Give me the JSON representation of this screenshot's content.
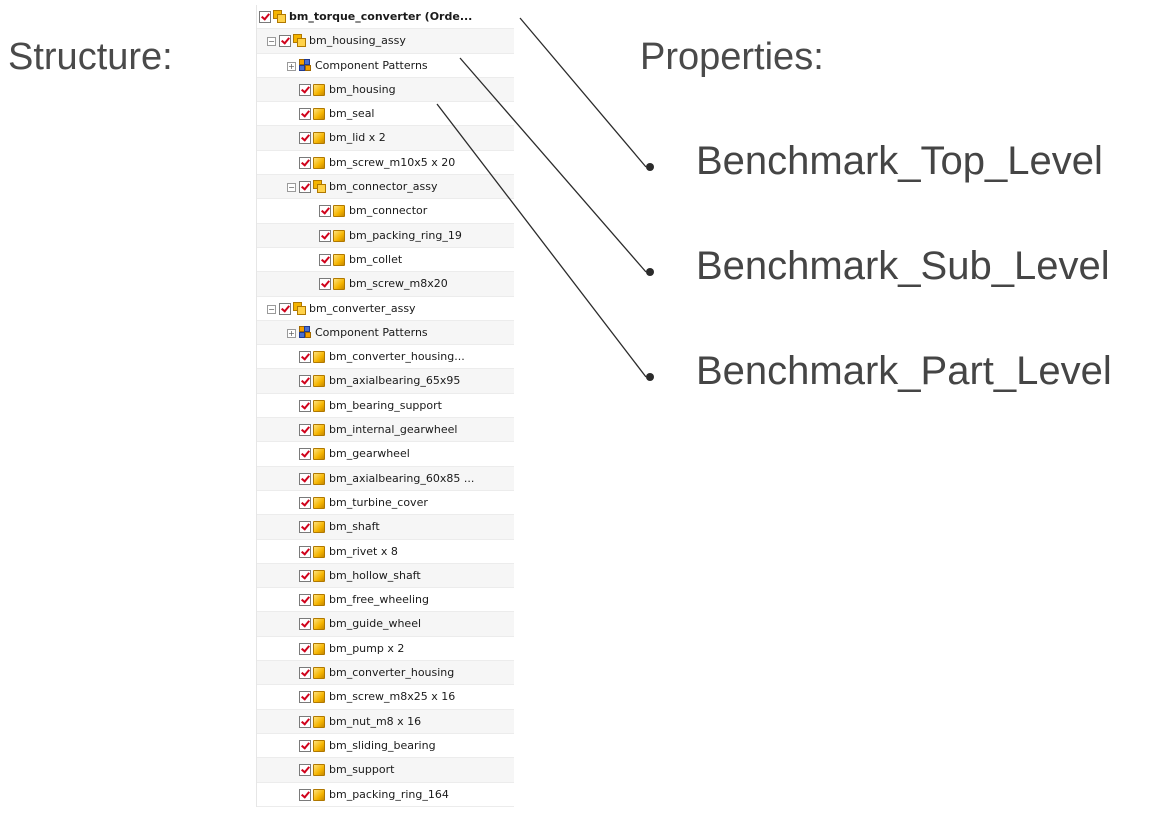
{
  "headings": {
    "structure": "Structure:",
    "properties": "Properties:"
  },
  "tree": [
    {
      "label": "bm_torque_converter (Orde...",
      "level": 0,
      "type": "asm",
      "expander": "",
      "bold": true
    },
    {
      "label": "bm_housing_assy",
      "level": 1,
      "type": "asm",
      "expander": "−"
    },
    {
      "label": "Component Patterns",
      "level": 2,
      "type": "pattern",
      "expander": "+"
    },
    {
      "label": "bm_housing",
      "level": 2,
      "type": "part",
      "expander": ""
    },
    {
      "label": "bm_seal",
      "level": 2,
      "type": "part",
      "expander": ""
    },
    {
      "label": "bm_lid x 2",
      "level": 2,
      "type": "part",
      "expander": ""
    },
    {
      "label": "bm_screw_m10x5 x 20",
      "level": 2,
      "type": "part",
      "expander": ""
    },
    {
      "label": "bm_connector_assy",
      "level": 2,
      "type": "asm",
      "expander": "−"
    },
    {
      "label": "bm_connector",
      "level": 3,
      "type": "part",
      "expander": ""
    },
    {
      "label": "bm_packing_ring_19",
      "level": 3,
      "type": "part",
      "expander": ""
    },
    {
      "label": "bm_collet",
      "level": 3,
      "type": "part",
      "expander": ""
    },
    {
      "label": "bm_screw_m8x20",
      "level": 3,
      "type": "part",
      "expander": ""
    },
    {
      "label": "bm_converter_assy",
      "level": 1,
      "type": "asm",
      "expander": "−"
    },
    {
      "label": "Component Patterns",
      "level": 2,
      "type": "pattern",
      "expander": "+"
    },
    {
      "label": "bm_converter_housing...",
      "level": 2,
      "type": "part",
      "expander": ""
    },
    {
      "label": "bm_axialbearing_65x95",
      "level": 2,
      "type": "part",
      "expander": ""
    },
    {
      "label": "bm_bearing_support",
      "level": 2,
      "type": "part",
      "expander": ""
    },
    {
      "label": "bm_internal_gearwheel",
      "level": 2,
      "type": "part",
      "expander": ""
    },
    {
      "label": "bm_gearwheel",
      "level": 2,
      "type": "part",
      "expander": ""
    },
    {
      "label": "bm_axialbearing_60x85 ...",
      "level": 2,
      "type": "part",
      "expander": ""
    },
    {
      "label": "bm_turbine_cover",
      "level": 2,
      "type": "part",
      "expander": ""
    },
    {
      "label": "bm_shaft",
      "level": 2,
      "type": "part",
      "expander": ""
    },
    {
      "label": "bm_rivet x 8",
      "level": 2,
      "type": "part",
      "expander": ""
    },
    {
      "label": "bm_hollow_shaft",
      "level": 2,
      "type": "part",
      "expander": ""
    },
    {
      "label": "bm_free_wheeling",
      "level": 2,
      "type": "part",
      "expander": ""
    },
    {
      "label": "bm_guide_wheel",
      "level": 2,
      "type": "part",
      "expander": ""
    },
    {
      "label": "bm_pump x 2",
      "level": 2,
      "type": "part",
      "expander": ""
    },
    {
      "label": "bm_converter_housing",
      "level": 2,
      "type": "part",
      "expander": ""
    },
    {
      "label": "bm_screw_m8x25 x 16",
      "level": 2,
      "type": "part",
      "expander": ""
    },
    {
      "label": "bm_nut_m8 x 16",
      "level": 2,
      "type": "part",
      "expander": ""
    },
    {
      "label": "bm_sliding_bearing",
      "level": 2,
      "type": "part",
      "expander": ""
    },
    {
      "label": "bm_support",
      "level": 2,
      "type": "part",
      "expander": ""
    },
    {
      "label": "bm_packing_ring_164",
      "level": 2,
      "type": "part",
      "expander": ""
    }
  ],
  "properties": [
    {
      "label": "Benchmark_Top_Level",
      "source_row": 0
    },
    {
      "label": "Benchmark_Sub_Level",
      "source_row": 1
    },
    {
      "label": "Benchmark_Part_Level",
      "source_row": 3
    }
  ]
}
